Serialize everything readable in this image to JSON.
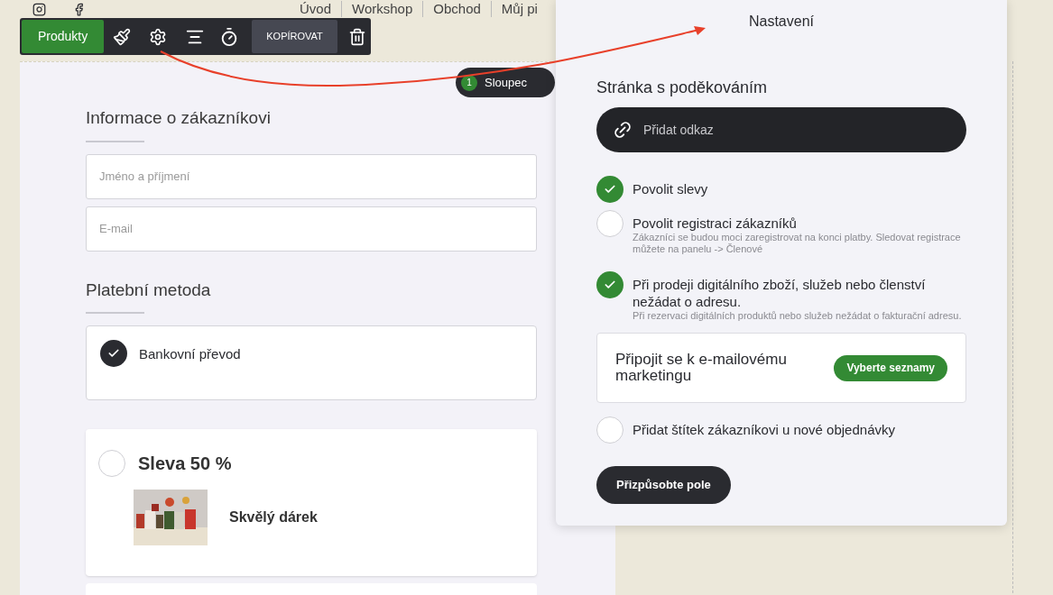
{
  "nav": {
    "links": [
      {
        "label": "Úvod"
      },
      {
        "label": "Workshop"
      },
      {
        "label": "Obchod"
      },
      {
        "label": "Můj pi"
      }
    ]
  },
  "toolbar": {
    "label": "Produkty",
    "copy": "KOPÍROVAT"
  },
  "column_badge": {
    "count": "1",
    "label": "Sloupec"
  },
  "form": {
    "customer": {
      "title": "Informace o zákazníkovi",
      "fields": [
        {
          "placeholder": "Jméno a příjmení"
        },
        {
          "placeholder": "E-mail"
        }
      ]
    },
    "payment": {
      "title": "Platební metoda",
      "methods": [
        {
          "label": "Bankovní převod",
          "selected": true
        }
      ]
    },
    "products": [
      {
        "title": "Sleva 50 %",
        "selected": false,
        "item": "Skvělý dárek"
      }
    ]
  },
  "settings": {
    "title": "Nastavení",
    "thanks_heading": "Stránka s poděkováním",
    "link_placeholder": "Přidat odkaz",
    "options": [
      {
        "label": "Povolit slevy",
        "checked": true
      },
      {
        "label": "Povolit registraci zákazníků",
        "checked": false,
        "hint": "Zákazníci se budou moci zaregistrovat na konci platby. Sledovat registrace můžete na panelu -> Členové"
      },
      {
        "label": "Při prodeji digitálního zboží, služeb nebo členství nežádat o adresu.",
        "checked": true,
        "hint": "Při rezervaci digitálních produktů nebo služeb nežádat o fakturační adresu."
      }
    ],
    "marketing": {
      "label": "Připojit se k e-mailovému marketingu",
      "button": "Vyberte seznamy"
    },
    "tag_option": {
      "label": "Přidat štítek zákazníkovi u nové objednávky",
      "checked": false
    },
    "customize_button": "Přizpůsobte pole"
  }
}
